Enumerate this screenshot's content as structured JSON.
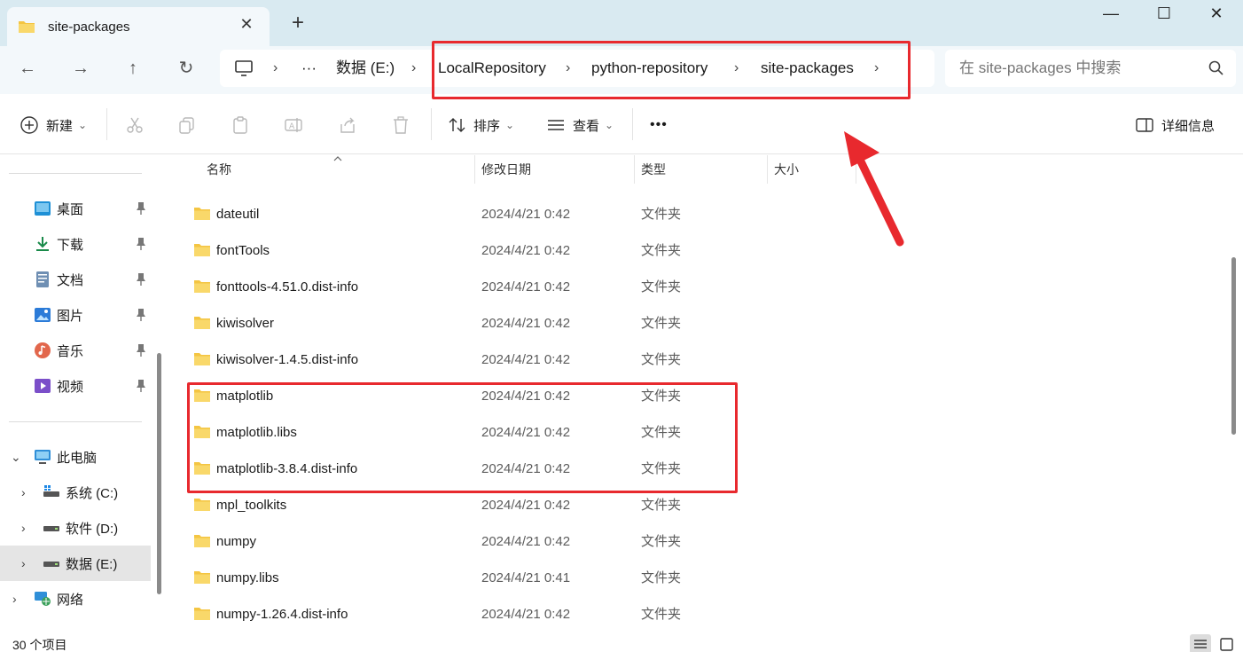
{
  "window": {
    "tab_title": "site-packages",
    "close_tab_glyph": "✕",
    "new_tab_glyph": "+",
    "minimize_glyph": "—",
    "maximize_glyph": "☐",
    "close_glyph": "✕"
  },
  "nav": {
    "back_glyph": "←",
    "forward_glyph": "→",
    "up_glyph": "↑",
    "refresh_glyph": "↻"
  },
  "address": {
    "more_glyph": "···",
    "sep_glyph": "›",
    "crumbs": [
      "数据 (E:)",
      "LocalRepository",
      "python-repository",
      "site-packages"
    ]
  },
  "search": {
    "placeholder": "在 site-packages 中搜索"
  },
  "toolbar": {
    "new_label": "新建",
    "sort_label": "排序",
    "view_label": "查看",
    "more_glyph": "•••",
    "details_label": "详细信息",
    "dropdown_glyph": "⌄"
  },
  "sidebar": {
    "quick_access": [
      {
        "label": "桌面",
        "icon": "desktop-icon"
      },
      {
        "label": "下载",
        "icon": "download-icon"
      },
      {
        "label": "文档",
        "icon": "document-icon"
      },
      {
        "label": "图片",
        "icon": "pictures-icon"
      },
      {
        "label": "音乐",
        "icon": "music-icon"
      },
      {
        "label": "视频",
        "icon": "video-icon"
      }
    ],
    "this_pc": "此电脑",
    "drives": [
      "系统 (C:)",
      "软件 (D:)",
      "数据 (E:)"
    ],
    "network": "网络",
    "expand_glyph": "›",
    "collapse_glyph": "⌄"
  },
  "columns": {
    "name": "名称",
    "modified": "修改日期",
    "type": "类型",
    "size": "大小"
  },
  "files": [
    {
      "name": "dateutil",
      "modified": "2024/4/21 0:42",
      "type": "文件夹"
    },
    {
      "name": "fontTools",
      "modified": "2024/4/21 0:42",
      "type": "文件夹"
    },
    {
      "name": "fonttools-4.51.0.dist-info",
      "modified": "2024/4/21 0:42",
      "type": "文件夹"
    },
    {
      "name": "kiwisolver",
      "modified": "2024/4/21 0:42",
      "type": "文件夹"
    },
    {
      "name": "kiwisolver-1.4.5.dist-info",
      "modified": "2024/4/21 0:42",
      "type": "文件夹"
    },
    {
      "name": "matplotlib",
      "modified": "2024/4/21 0:42",
      "type": "文件夹"
    },
    {
      "name": "matplotlib.libs",
      "modified": "2024/4/21 0:42",
      "type": "文件夹"
    },
    {
      "name": "matplotlib-3.8.4.dist-info",
      "modified": "2024/4/21 0:42",
      "type": "文件夹"
    },
    {
      "name": "mpl_toolkits",
      "modified": "2024/4/21 0:42",
      "type": "文件夹"
    },
    {
      "name": "numpy",
      "modified": "2024/4/21 0:42",
      "type": "文件夹"
    },
    {
      "name": "numpy.libs",
      "modified": "2024/4/21 0:41",
      "type": "文件夹"
    },
    {
      "name": "numpy-1.26.4.dist-info",
      "modified": "2024/4/21 0:42",
      "type": "文件夹"
    }
  ],
  "status": {
    "item_count": "30 个项目"
  },
  "colors": {
    "annotation": "#e8292e",
    "folder": "#f4c542",
    "titlebar": "#d9eaf1"
  }
}
